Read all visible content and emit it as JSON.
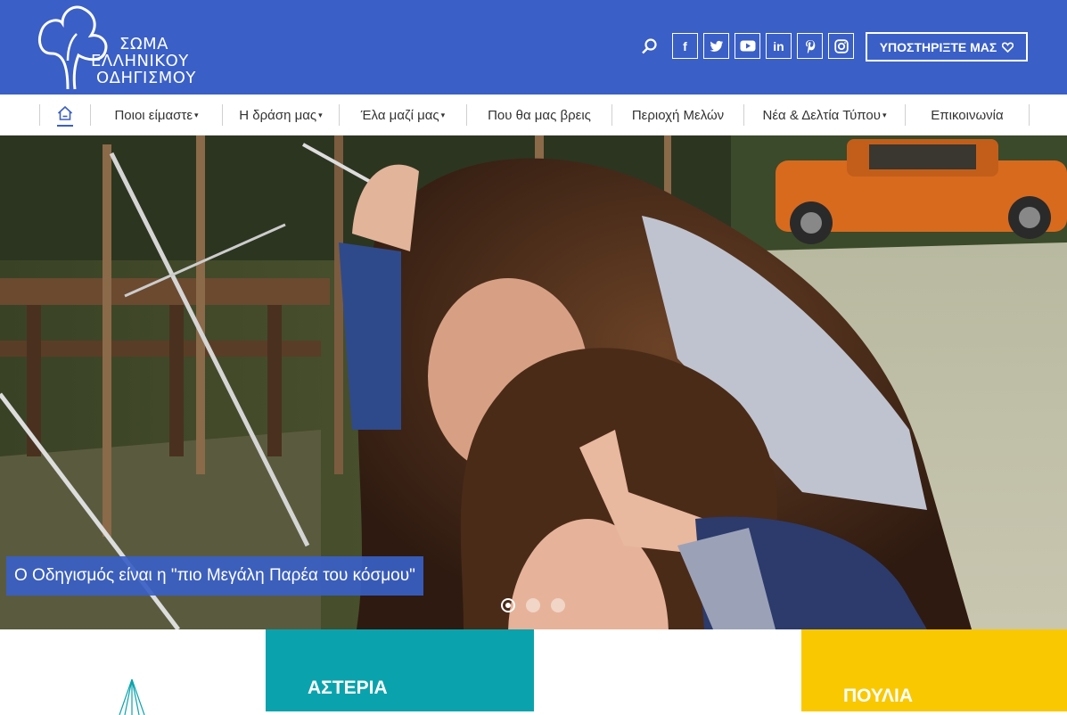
{
  "logo": {
    "line1": "ΣΩΜΑ",
    "line2": "ΕΛΛΗΝΙΚΟΥ",
    "line3": "ΟΔΗΓΙΣΜΟΥ"
  },
  "header": {
    "search_icon": "search-icon",
    "socials": [
      {
        "name": "facebook-icon",
        "glyph": "f"
      },
      {
        "name": "twitter-icon",
        "glyph": "t"
      },
      {
        "name": "youtube-icon",
        "glyph": "▶"
      },
      {
        "name": "linkedin-icon",
        "glyph": "in"
      },
      {
        "name": "pinterest-icon",
        "glyph": "p"
      },
      {
        "name": "instagram-icon",
        "glyph": "◎"
      }
    ],
    "support_label": "ΥΠΟΣΤΗΡΙΞΤΕ ΜΑΣ"
  },
  "nav": {
    "home_icon": "home-icon",
    "items": [
      {
        "label": "Ποιοι είμαστε"
      },
      {
        "label": "Η δράση μας"
      },
      {
        "label": "Έλα μαζί μας"
      },
      {
        "label": "Που θα μας βρεις"
      },
      {
        "label": "Περιοχή Μελών"
      },
      {
        "label": "Νέα & Δελτία Τύπου"
      },
      {
        "label": "Επικοινωνία"
      }
    ]
  },
  "hero": {
    "caption": "Ο Οδηγισμός είναι η \"πιο Μεγάλη Παρέα του κόσμου\"",
    "active_slide": 1,
    "slide_count": 3
  },
  "tiles": [
    {
      "title": "",
      "color": "#ffffff"
    },
    {
      "title": "ΑΣΤΕΡΙΑ",
      "color": "#0aa3ad"
    },
    {
      "title": "",
      "color": "#ffffff"
    },
    {
      "title": "ΠΟΥΛΙΑ",
      "color": "#f9c800"
    }
  ],
  "colors": {
    "brand": "#3a5fc6",
    "teal": "#0aa3ad",
    "yellow": "#f9c800"
  }
}
